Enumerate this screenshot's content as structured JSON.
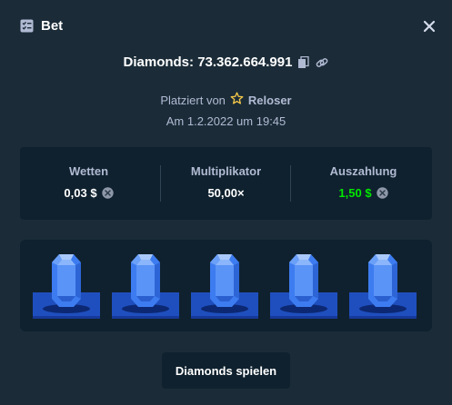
{
  "header": {
    "title": "Bet",
    "icon": "bet-slip-icon",
    "close_icon": "close-icon"
  },
  "headline": {
    "text": "Diamonds: 73.362.664.991",
    "copy_icon": "copy-icon",
    "link_icon": "link-icon"
  },
  "placed": {
    "prefix": "Platziert von",
    "user": "Reloser",
    "user_icon": "star-icon"
  },
  "date": "Am 1.2.2022 um 19:45",
  "stats": [
    {
      "label": "Wetten",
      "value": "0,03 $",
      "icon": "currency-coin-icon"
    },
    {
      "label": "Multiplikator",
      "value": "50,00×"
    },
    {
      "label": "Auszahlung",
      "value": "1,50 $",
      "icon": "currency-coin-icon"
    }
  ],
  "board": {
    "tiles": [
      "blue-diamond",
      "blue-diamond",
      "blue-diamond",
      "blue-diamond",
      "blue-diamond"
    ]
  },
  "play_button": {
    "label": "Diamonds spielen"
  },
  "colors": {
    "background": "#1b2c38",
    "panel": "#0f212e",
    "muted_text": "#b1bad3",
    "payout_green": "#00e701",
    "gem_blue": "#3d7cf0",
    "pedestal_blue": "#1f4fbe"
  }
}
